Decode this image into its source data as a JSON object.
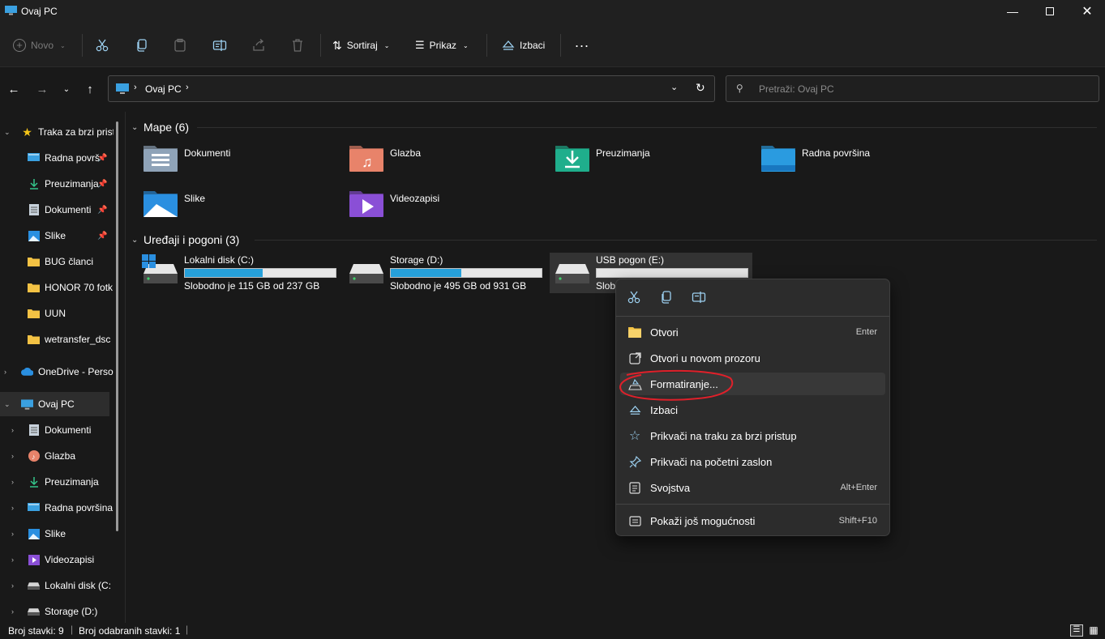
{
  "window": {
    "title": "Ovaj PC"
  },
  "commandbar": {
    "new_label": "Novo",
    "sort_label": "Sortiraj",
    "view_label": "Prikaz",
    "eject_label": "Izbaci",
    "more_label": "..."
  },
  "address": {
    "path_label": "Ovaj PC",
    "search_placeholder": "Pretraži: Ovaj PC"
  },
  "sidebar": {
    "items": [
      {
        "label": "Traka za brzi prist",
        "icon": "star-icon"
      },
      {
        "label": "Radna površ",
        "icon": "desktop-icon"
      },
      {
        "label": "Preuzimanja",
        "icon": "download-icon"
      },
      {
        "label": "Dokumenti",
        "icon": "document-icon"
      },
      {
        "label": "Slike",
        "icon": "pictures-icon"
      },
      {
        "label": "BUG članci",
        "icon": "folder-icon"
      },
      {
        "label": "HONOR 70 fotk",
        "icon": "folder-icon"
      },
      {
        "label": "UUN",
        "icon": "folder-icon"
      },
      {
        "label": "wetransfer_dsc",
        "icon": "folder-icon"
      },
      {
        "label": "OneDrive - Perso",
        "icon": "cloud-icon"
      },
      {
        "label": "Ovaj PC",
        "icon": "computer-icon"
      },
      {
        "label": "Dokumenti",
        "icon": "document-icon"
      },
      {
        "label": "Glazba",
        "icon": "music-icon"
      },
      {
        "label": "Preuzimanja",
        "icon": "download-icon"
      },
      {
        "label": "Radna površina",
        "icon": "desktop-icon"
      },
      {
        "label": "Slike",
        "icon": "pictures-icon"
      },
      {
        "label": "Videozapisi",
        "icon": "video-icon"
      },
      {
        "label": "Lokalni disk (C:",
        "icon": "drive-icon"
      },
      {
        "label": "Storage (D:)",
        "icon": "drive-icon"
      }
    ]
  },
  "main": {
    "folders_header": "Mape (6)",
    "folders": [
      {
        "name": "Dokumenti",
        "color": "#8fa3b8"
      },
      {
        "name": "Glazba",
        "color": "#e8836a"
      },
      {
        "name": "Preuzimanja",
        "color": "#1fae8c"
      },
      {
        "name": "Radna površina",
        "color": "#2a9be0"
      },
      {
        "name": "Slike",
        "color": "#2a8fe0"
      },
      {
        "name": "Videozapisi",
        "color": "#8a4fd6"
      }
    ],
    "drives_header": "Uređaji i pogoni (3)",
    "drives": [
      {
        "name": "Lokalni disk (C:)",
        "free": "Slobodno je 115 GB od 237 GB",
        "used_fraction": 0.515
      },
      {
        "name": "Storage (D:)",
        "free": "Slobodno je 495 GB od 931 GB",
        "used_fraction": 0.468
      },
      {
        "name": "USB pogon (E:)",
        "free": "Slob",
        "used_fraction": 0.0
      }
    ]
  },
  "context_menu": {
    "items": [
      {
        "label": "Otvori",
        "shortcut": "Enter",
        "icon": "open-folder-icon"
      },
      {
        "label": "Otvori u novom prozoru",
        "shortcut": "",
        "icon": "new-window-icon"
      },
      {
        "label": "Formatiranje...",
        "shortcut": "",
        "icon": "format-icon"
      },
      {
        "label": "Izbaci",
        "shortcut": "",
        "icon": "eject-icon"
      },
      {
        "label": "Prikvači na traku za brzi pristup",
        "shortcut": "",
        "icon": "star-outline-icon"
      },
      {
        "label": "Prikvači na početni zaslon",
        "shortcut": "",
        "icon": "pin-icon"
      },
      {
        "label": "Svojstva",
        "shortcut": "Alt+Enter",
        "icon": "properties-icon"
      },
      {
        "label": "Pokaži još mogućnosti",
        "shortcut": "Shift+F10",
        "icon": "more-options-icon"
      }
    ]
  },
  "statusbar": {
    "item_count": "Broj stavki: 9",
    "selected_count": "Broj odabranih stavki: 1"
  },
  "colors": {
    "accent": "#26a0da",
    "highlight_ring": "#e0202a"
  }
}
